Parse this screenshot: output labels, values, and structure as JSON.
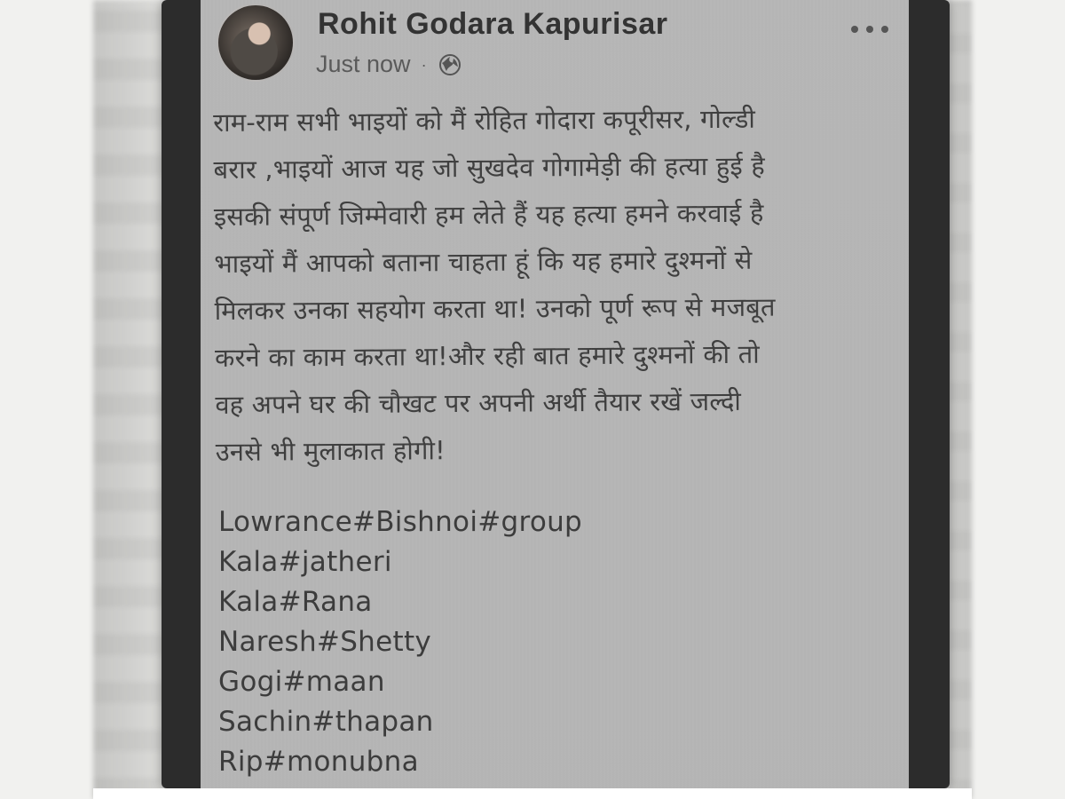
{
  "post": {
    "author_name": "Rohit Godara Kapurisar",
    "timestamp": "Just now",
    "separator": "·",
    "privacy_icon": "globe-icon",
    "more_icon": "more-options-icon",
    "body_lines": [
      "राम-राम सभी भाइयों को मैं रोहित गोदारा कपूरीसर, गोल्डी",
      "बरार ,भाइयों आज यह जो सुखदेव गोगामेड़ी की हत्या हुई है",
      "इसकी संपूर्ण जिम्मेवारी हम लेते हैं यह हत्या हमने करवाई है",
      "भाइयों मैं आपको बताना चाहता हूं कि यह हमारे दुश्मनों से",
      "मिलकर उनका सहयोग करता था! उनको पूर्ण रूप से मजबूत",
      "करने का काम करता था!और रही बात हमारे दुश्मनों की तो",
      "वह अपने घर की चौखट पर अपनी अर्थी तैयार रखें जल्दी",
      "उनसे भी मुलाकात होगी!"
    ],
    "tags": [
      "Lowrance#Bishnoi#group",
      "Kala#jatheri",
      "Kala#Rana",
      "Naresh#Shetty",
      "Gogi#maan",
      "Sachin#thapan",
      "Rip#monubna"
    ]
  }
}
